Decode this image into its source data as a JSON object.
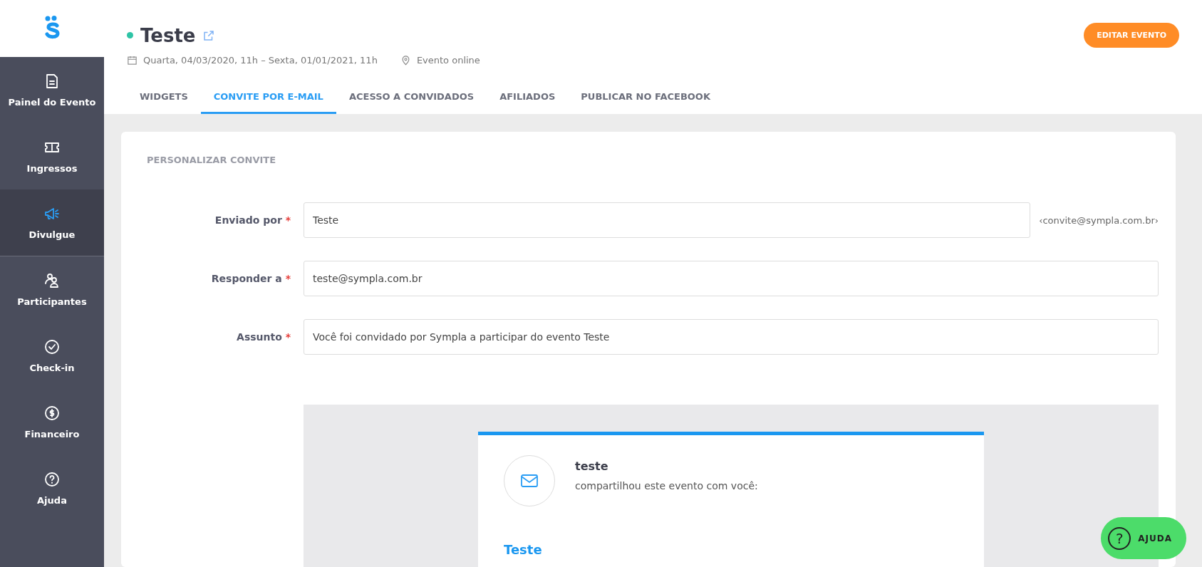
{
  "sidebar": {
    "items": [
      {
        "kind": "panel",
        "label": "Painel do Evento",
        "selected": false
      },
      {
        "kind": "ticket",
        "label": "Ingressos",
        "selected": false
      },
      {
        "kind": "megaphone",
        "label": "Divulgue",
        "selected": true
      },
      {
        "kind": "people",
        "label": "Participantes",
        "selected": false
      },
      {
        "kind": "check",
        "label": "Check-in",
        "selected": false
      },
      {
        "kind": "money",
        "label": "Financeiro",
        "selected": false
      },
      {
        "kind": "help",
        "label": "Ajuda",
        "selected": false
      }
    ]
  },
  "event": {
    "title": "Teste",
    "status_dot": {
      "color": "#2ec4a6"
    },
    "dates": "Quarta, 04/03/2020, 11h – Sexta, 01/01/2021, 11h",
    "location": "Evento online",
    "edit_button": "EDITAR EVENTO"
  },
  "tabs": [
    {
      "label": "WIDGETS",
      "selected": false
    },
    {
      "label": "CONVITE POR E-MAIL",
      "selected": true
    },
    {
      "label": "ACESSO A CONVIDADOS",
      "selected": false
    },
    {
      "label": "AFILIADOS",
      "selected": false
    },
    {
      "label": "PUBLICAR NO FACEBOOK",
      "selected": false
    }
  ],
  "form": {
    "title": "PERSONALIZAR CONVITE",
    "fields": [
      {
        "label": "Enviado por",
        "required": true,
        "value": "Teste",
        "suffix": "‹convite@sympla.com.br›"
      },
      {
        "label": "Responder a",
        "required": true,
        "value": "teste@sympla.com.br"
      },
      {
        "label": "Assunto",
        "required": true,
        "value": "Você foi convidado por Sympla a participar do evento Teste"
      }
    ],
    "required_mark": "*"
  },
  "preview": {
    "sender": "teste",
    "message": "compartilhou este evento com você:",
    "event_title": "Teste"
  },
  "help_button": {
    "icon": "?",
    "label": "AJUDA"
  }
}
